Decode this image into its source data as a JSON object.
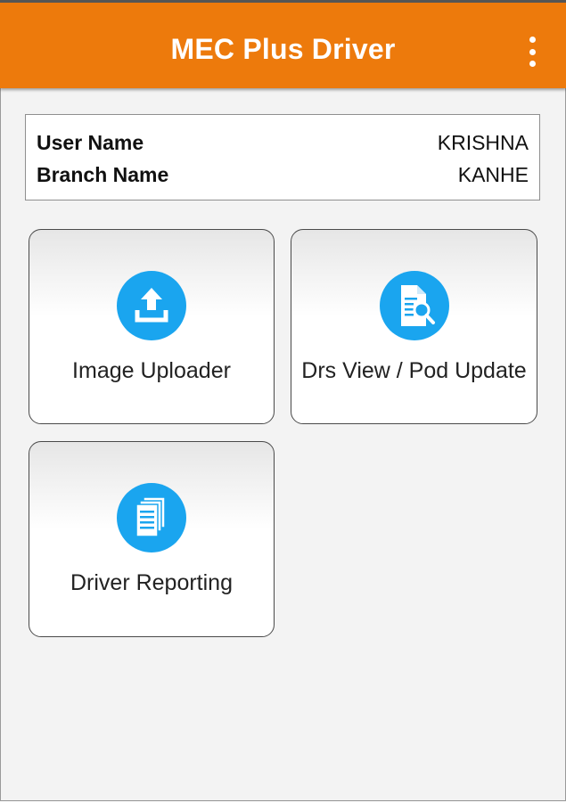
{
  "app_bar": {
    "title": "MEC Plus Driver",
    "menu_icon": "more-vert-icon",
    "color": "#ed7a0c"
  },
  "user_info": {
    "user_label": "User Name",
    "user_value": "KRISHNA",
    "branch_label": "Branch Name",
    "branch_value": "KANHE"
  },
  "tiles": [
    {
      "label": "Image Uploader",
      "icon": "upload-icon"
    },
    {
      "label": "Drs View / Pod Update",
      "icon": "document-search-icon"
    },
    {
      "label": "Driver Reporting",
      "icon": "documents-icon"
    }
  ],
  "accent_color": "#1aa5ef"
}
